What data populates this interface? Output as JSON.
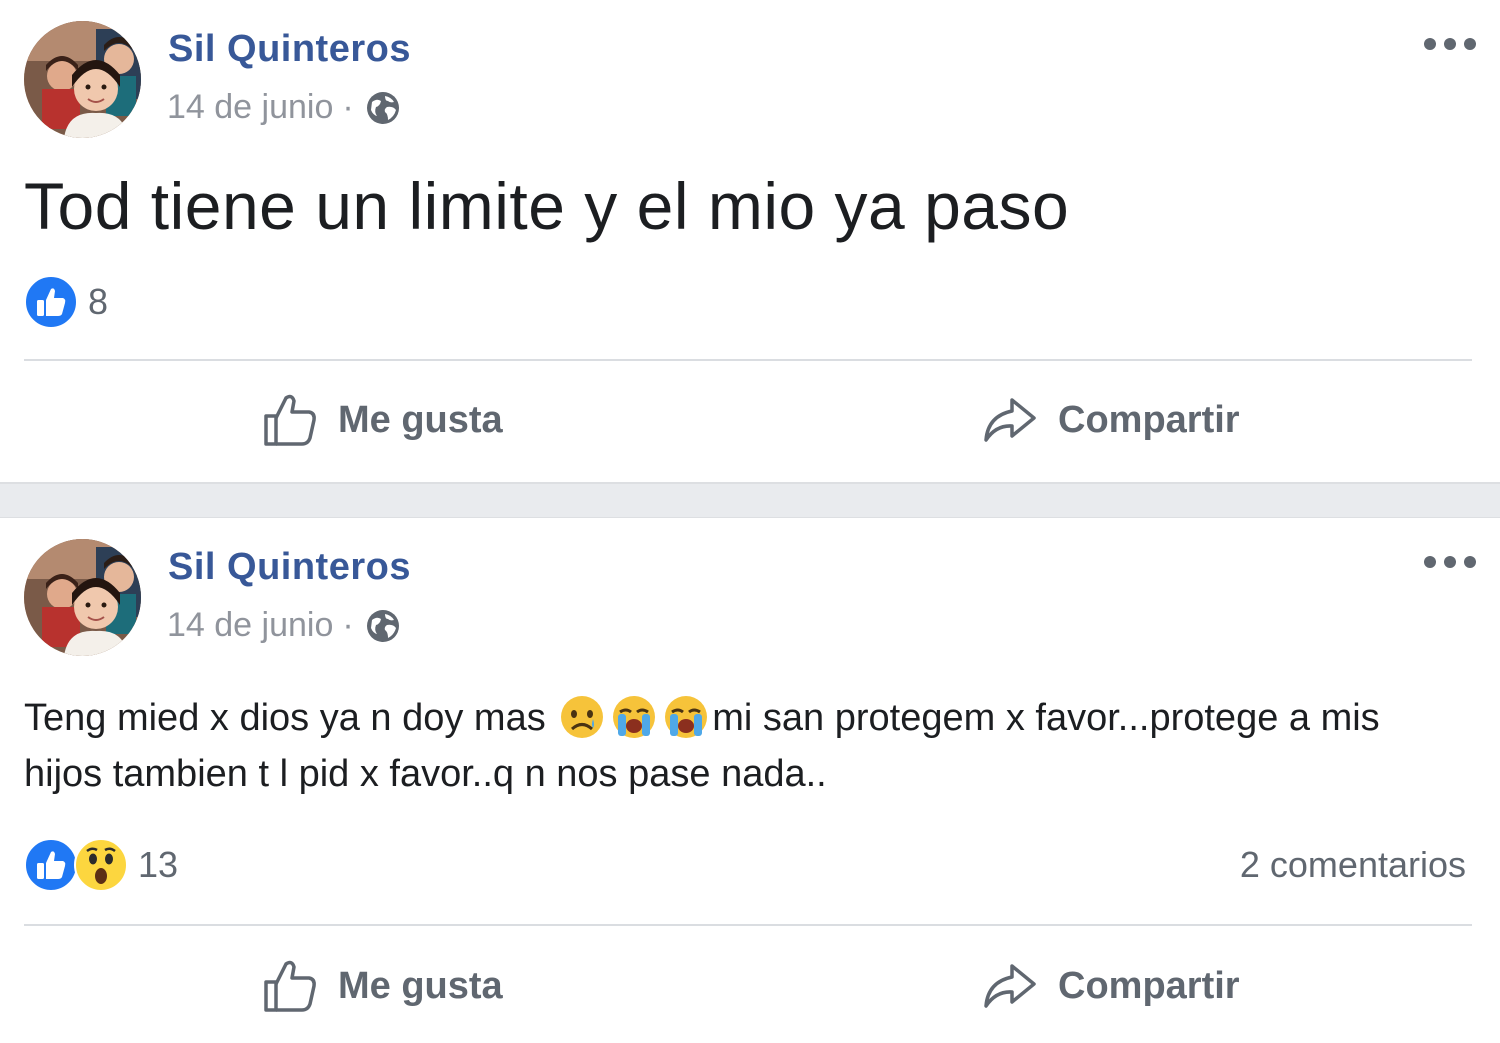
{
  "colors": {
    "author_link": "#385898",
    "meta_gray": "#90949c",
    "action_gray": "#606770",
    "like_blue": "#2078f4",
    "feed_bg": "#e9ebee"
  },
  "posts": [
    {
      "author": "Sil Quinteros",
      "date": "14 de junio",
      "separator": "·",
      "privacy_icon": "globe-icon",
      "text": "Tod tiene un limite y el mio ya paso",
      "reactions": [
        "like"
      ],
      "reaction_count": "8",
      "comments": "",
      "actions": {
        "like": "Me gusta",
        "share": "Compartir"
      }
    },
    {
      "author": "Sil Quinteros",
      "date": "14 de junio",
      "separator": "·",
      "privacy_icon": "globe-icon",
      "text_part1": "Teng mied x dios ya n doy mas ",
      "emojis": [
        "sad-face-emoji",
        "crying-face-emoji",
        "crying-face-emoji"
      ],
      "text_part2": "mi san protegem x favor...protege a mis hijos tambien t l pid x favor..q n nos pase nada..",
      "reactions": [
        "like",
        "wow"
      ],
      "reaction_count": "13",
      "comments": "2 comentarios",
      "actions": {
        "like": "Me gusta",
        "share": "Compartir"
      }
    }
  ]
}
